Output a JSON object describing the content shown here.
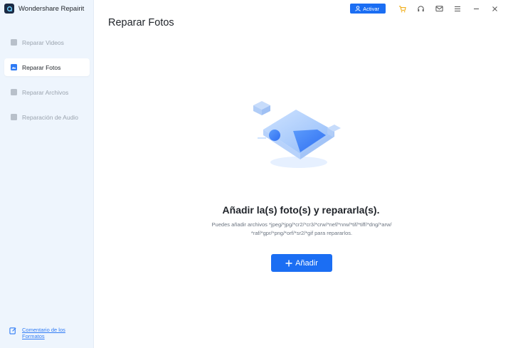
{
  "app": {
    "title": "Wondershare Repairit"
  },
  "sidebar": {
    "items": [
      {
        "label": "Reparar Videos",
        "icon": "video-icon"
      },
      {
        "label": "Reparar Fotos",
        "icon": "photo-icon",
        "active": true
      },
      {
        "label": "Reparar Archivos",
        "icon": "file-icon"
      },
      {
        "label": "Reparación de Audio",
        "icon": "audio-icon"
      }
    ],
    "feedback_label": "Comentario de los Formatos"
  },
  "topbar": {
    "activate_label": "Activar",
    "icons": [
      "user-icon",
      "cart-icon",
      "headset-icon",
      "mail-icon",
      "menu-icon",
      "minimize-icon",
      "close-icon"
    ]
  },
  "main": {
    "page_title": "Reparar Fotos",
    "headline": "Añadir la(s) foto(s) y repararla(s).",
    "description": "Puedes añadir archivos *jpeg/*jpg/*cr2/*cr3/*crw/*nef/*nrw/*tif/*tiff/*dng/*arw/ *raf/*gpr/*png/*orf/*sr2/*gif para repararlos.",
    "add_button_label": "Añadir"
  },
  "colors": {
    "accent": "#1b6ef3",
    "sidebar_bg": "#eef5fd",
    "illustration_blue": "#4b8ef9"
  }
}
